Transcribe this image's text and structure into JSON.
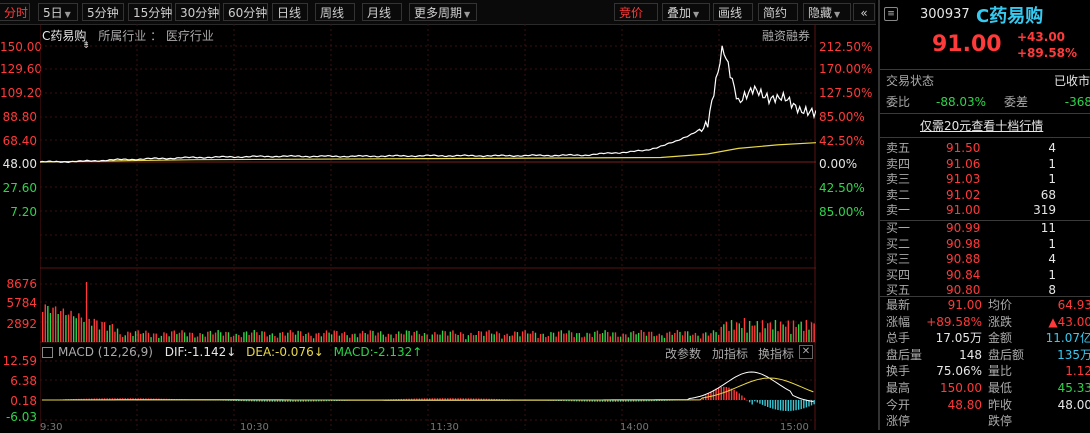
{
  "toolbar": {
    "left_items": [
      "分时",
      "5日",
      "5分钟",
      "15分钟",
      "30分钟",
      "60分钟",
      "日线",
      "周线",
      "月线",
      "更多周期"
    ],
    "right_items": [
      "竞价",
      "叠加",
      "画线",
      "简约",
      "隐藏"
    ],
    "collapse_glyph": "«"
  },
  "chart": {
    "stock_name": "C药易购",
    "industry_label": "所属行业",
    "industry_value": "医疗行业",
    "margin_trading": "融资融券",
    "price_ticks": [
      "150.00",
      "129.60",
      "109.20",
      "88.80",
      "68.40",
      "48.00",
      "27.60",
      "7.20"
    ],
    "pct_ticks": [
      "212.50%",
      "170.00%",
      "127.50%",
      "85.00%",
      "42.50%",
      "0.00%",
      "42.50%",
      "85.00%"
    ],
    "volume_ticks": [
      "8676",
      "5784",
      "2892"
    ],
    "macd_ticks": [
      "12.59",
      "6.38",
      "0.18",
      "-6.03"
    ],
    "time_ticks": [
      "9:30",
      "10:30",
      "11:30",
      "14:00",
      "15:00"
    ],
    "macd": {
      "label": "MACD (12,26,9)",
      "dif": "DIF:-1.142",
      "dea": "DEA:-0.076",
      "macd": "MACD:-2.132",
      "down_arrow": "↓",
      "up_arrow": "↑",
      "buttons": [
        "改参数",
        "加指标",
        "换指标"
      ],
      "close": "✕"
    },
    "colors": {
      "price_line": "#ffffff",
      "avg_line": "#e8d84a",
      "up": "#ff3a3a",
      "down": "#2fd44a",
      "macd_neg": "#37c9d6",
      "grid": "#3a1010"
    }
  },
  "chart_data": {
    "type": "line",
    "title": "C药易购",
    "x_range": [
      "9:30",
      "15:00"
    ],
    "ylim": [
      7.2,
      150.0
    ],
    "series": [
      {
        "name": "price",
        "x_fraction": [
          0.0,
          0.05,
          0.1,
          0.2,
          0.3,
          0.4,
          0.5,
          0.6,
          0.7,
          0.78,
          0.82,
          0.86,
          0.88,
          0.9,
          0.92,
          0.94,
          0.96,
          0.98,
          1.0
        ],
        "values": [
          48.0,
          48.5,
          50.0,
          52.0,
          53.0,
          53.0,
          53.5,
          53.5,
          54.0,
          58.0,
          66.0,
          80.0,
          150.0,
          100.0,
          113.0,
          103.0,
          105.0,
          93.0,
          91.0
        ]
      },
      {
        "name": "avg",
        "x_fraction": [
          0.0,
          0.2,
          0.5,
          0.8,
          0.86,
          0.9,
          0.95,
          1.0
        ],
        "values": [
          48.0,
          50.0,
          51.0,
          52.0,
          55.0,
          60.0,
          63.0,
          64.93
        ]
      }
    ]
  },
  "quote": {
    "code": "300937",
    "name": "C药易购",
    "price": "91.00",
    "change": "+43.00",
    "change_pct": "+89.58%",
    "status_label": "交易状态",
    "status_value": "已收市",
    "weibi_label": "委比",
    "weibi_value": "-88.03%",
    "weicha_label": "委差",
    "weicha_value": "-368",
    "promo": "仅需20元查看十档行情",
    "asks": [
      {
        "label": "卖五",
        "price": "91.50",
        "vol": "4"
      },
      {
        "label": "卖四",
        "price": "91.06",
        "vol": "1"
      },
      {
        "label": "卖三",
        "price": "91.03",
        "vol": "1"
      },
      {
        "label": "卖二",
        "price": "91.02",
        "vol": "68"
      },
      {
        "label": "卖一",
        "price": "91.00",
        "vol": "319"
      }
    ],
    "bids": [
      {
        "label": "买一",
        "price": "90.99",
        "vol": "11"
      },
      {
        "label": "买二",
        "price": "90.98",
        "vol": "1"
      },
      {
        "label": "买三",
        "price": "90.88",
        "vol": "4"
      },
      {
        "label": "买四",
        "price": "90.84",
        "vol": "1"
      },
      {
        "label": "买五",
        "price": "90.80",
        "vol": "8"
      }
    ],
    "stats": [
      {
        "l1": "最新",
        "v1": "91.00",
        "c1": "red",
        "l2": "均价",
        "v2": "64.93",
        "c2": "red"
      },
      {
        "l1": "涨幅",
        "v1": "+89.58%",
        "c1": "red",
        "l2": "涨跌",
        "v2": "▲43.00",
        "c2": "red"
      },
      {
        "l1": "总手",
        "v1": "17.05万",
        "c1": "white",
        "l2": "金额",
        "v2": "11.07亿",
        "c2": "cyan"
      },
      {
        "l1": "盘后量",
        "v1": "148",
        "c1": "white",
        "l2": "盘后额",
        "v2": "135万",
        "c2": "cyan"
      },
      {
        "l1": "换手",
        "v1": "75.06%",
        "c1": "white",
        "l2": "量比",
        "v2": "1.12",
        "c2": "red"
      },
      {
        "l1": "最高",
        "v1": "150.00",
        "c1": "red",
        "l2": "最低",
        "v2": "45.33",
        "c2": "green"
      },
      {
        "l1": "今开",
        "v1": "48.80",
        "c1": "red",
        "l2": "昨收",
        "v2": "48.00",
        "c2": "white"
      },
      {
        "l1": "涨停",
        "v1": "",
        "c1": "red",
        "l2": "跌停",
        "v2": "",
        "c2": "green"
      }
    ]
  }
}
